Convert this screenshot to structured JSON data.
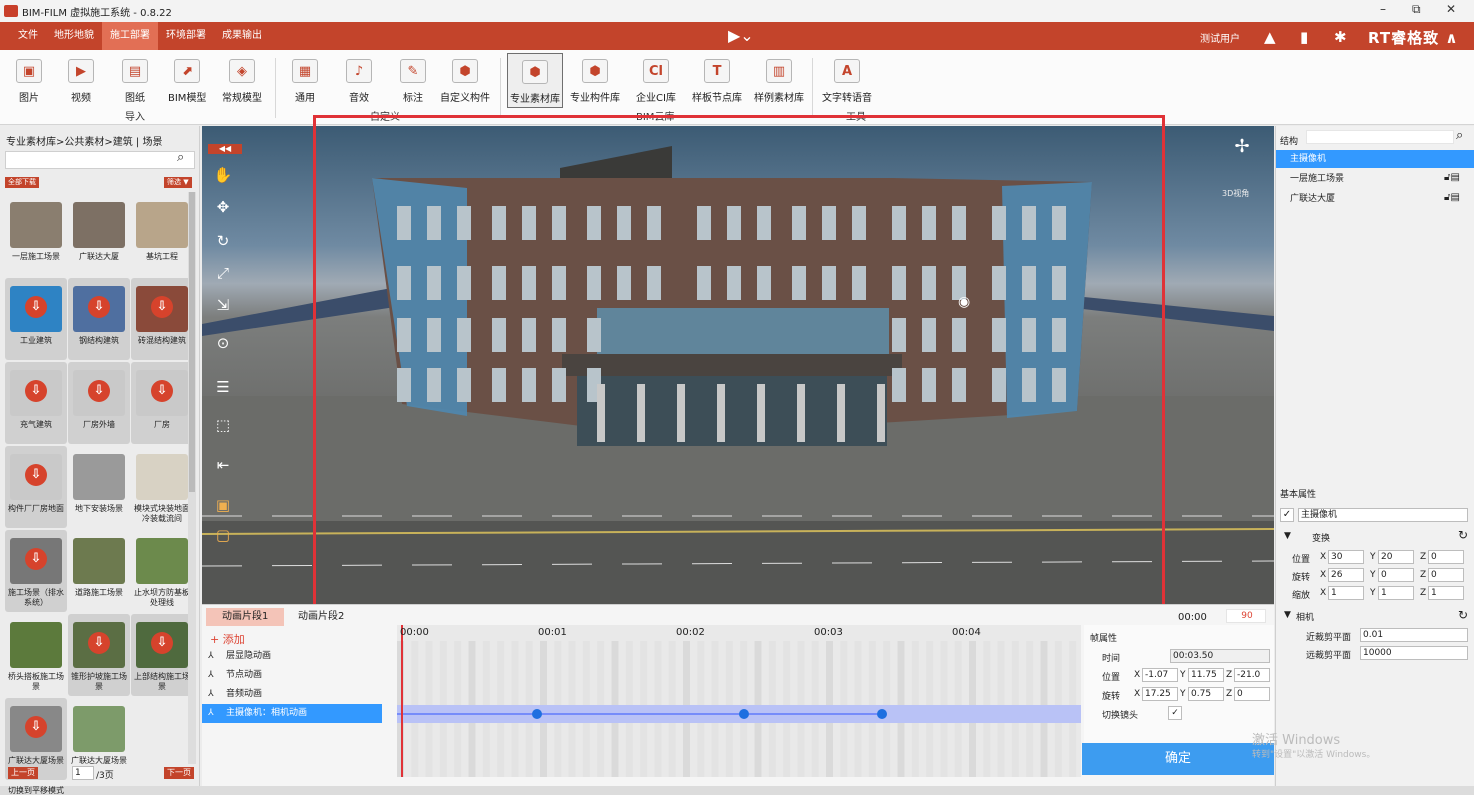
{
  "window": {
    "title": "BIM-FILM 虚拟施工系统 - 0.8.22",
    "minimize": "–",
    "restore": "⧉",
    "close": "✕"
  },
  "menu": {
    "items": [
      "文件",
      "地形地貌",
      "施工部署",
      "环境部署",
      "成果输出"
    ],
    "active_index": 2
  },
  "header": {
    "play": "▶⌄",
    "user": "测试用户",
    "brand": "RT睿格致 ∧"
  },
  "ribbon": {
    "import": [
      "图片",
      "视频",
      "图纸",
      "BIM模型",
      "常规模型"
    ],
    "import_group": "导入",
    "custom": [
      "通用",
      "音效",
      "标注",
      "自定义构件"
    ],
    "custom_group": "自定义",
    "library": [
      "专业素材库",
      "专业构件库",
      "企业CI库",
      "样板节点库",
      "样例素材库"
    ],
    "library_group": "BIM云库",
    "tools": [
      "文字转语音"
    ],
    "tools_group": "工具",
    "selected": "专业素材库"
  },
  "left": {
    "breadcrumb": "专业素材库>公共素材>建筑 | 场景",
    "download_all": "全部下载",
    "filter": "筛选 ▼",
    "items": [
      {
        "label": "一层施工场景",
        "dl": false,
        "color": "#8a7e6f"
      },
      {
        "label": "广联达大厦",
        "dl": false,
        "color": "#7d7064"
      },
      {
        "label": "基坑工程",
        "dl": false,
        "color": "#b8a58a"
      },
      {
        "label": "工业建筑",
        "dl": true,
        "color": "#2e83c4"
      },
      {
        "label": "钢结构建筑",
        "dl": true,
        "color": "#4f6fa0"
      },
      {
        "label": "砖混结构建筑",
        "dl": true,
        "color": "#8a4a3a"
      },
      {
        "label": "充气建筑",
        "dl": true,
        "color": "#c9c9c9"
      },
      {
        "label": "厂房外墙",
        "dl": true,
        "color": "#c9c9c9"
      },
      {
        "label": "厂房",
        "dl": true,
        "color": "#c9c9c9"
      },
      {
        "label": "构件厂厂房地面",
        "dl": true,
        "color": "#c9c9c9"
      },
      {
        "label": "地下安装场景",
        "dl": false,
        "color": "#9a9a9a"
      },
      {
        "label": "模块式块装地面冷装载流间",
        "dl": false,
        "color": "#d8d2c4"
      },
      {
        "label": "施工场景（排水系统）",
        "dl": true,
        "color": "#777"
      },
      {
        "label": "道路施工场景",
        "dl": false,
        "color": "#6d7a4f"
      },
      {
        "label": "止水坝方防基板处理线",
        "dl": false,
        "color": "#6c8a4c"
      },
      {
        "label": "桥头搭板施工场景",
        "dl": false,
        "color": "#5c7a3c"
      },
      {
        "label": "锥形护坡施工场景",
        "dl": true,
        "color": "#5b6e44"
      },
      {
        "label": "上部结构施工场景",
        "dl": true,
        "color": "#4f6a3e"
      },
      {
        "label": "广联达大厦场景",
        "dl": true,
        "color": "#888"
      },
      {
        "label": "广联达大厦场景",
        "dl": false,
        "color": "#7d9b6a"
      }
    ],
    "prev": "上一页",
    "page": "1",
    "total": "/3页",
    "next": "下一页"
  },
  "viewport": {
    "view_label": "3D视角"
  },
  "right": {
    "struct_label": "结构",
    "tree": [
      "主摄像机",
      "一层施工场景",
      "广联达大厦"
    ],
    "selected": "主摄像机",
    "basic_label": "基本属性",
    "name_value": "主摄像机",
    "transform_label": "变换",
    "rows": [
      {
        "label": "位置",
        "x": "30",
        "y": "20",
        "z": "0"
      },
      {
        "label": "旋转",
        "x": "26",
        "y": "0",
        "z": "0"
      },
      {
        "label": "缩放",
        "x": "1",
        "y": "1",
        "z": "1"
      }
    ],
    "camera_label": "相机",
    "near_label": "近裁剪平面",
    "near_value": "0.01",
    "far_label": "远裁剪平面",
    "far_value": "10000"
  },
  "timeline": {
    "tabs": [
      "动画片段1",
      "动画片段2"
    ],
    "time_current": "00:00",
    "time_end": "90",
    "add": "+ 添加",
    "ticks": [
      "00:00",
      "00:01",
      "00:02",
      "00:03",
      "00:04"
    ],
    "tracks": [
      "层显隐动画",
      "节点动画",
      "音频动画",
      "主摄像机：相机动画"
    ],
    "selected_track": 3,
    "frame_label": "帧属性",
    "time_label": "时间",
    "time_value": "00:03.50",
    "pos_label": "位置",
    "pos": {
      "x": "-1.07",
      "y": "11.75",
      "z": "-21.0"
    },
    "rot_label": "旋转",
    "rot": {
      "x": "17.25",
      "y": "0.75",
      "z": "0"
    },
    "switch_label": "切换镜头",
    "confirm": "确定",
    "watermark1": "激活 Windows",
    "watermark2": "转到\"设置\"以激活 Windows。"
  },
  "status": {
    "text": "切换到平移模式"
  }
}
